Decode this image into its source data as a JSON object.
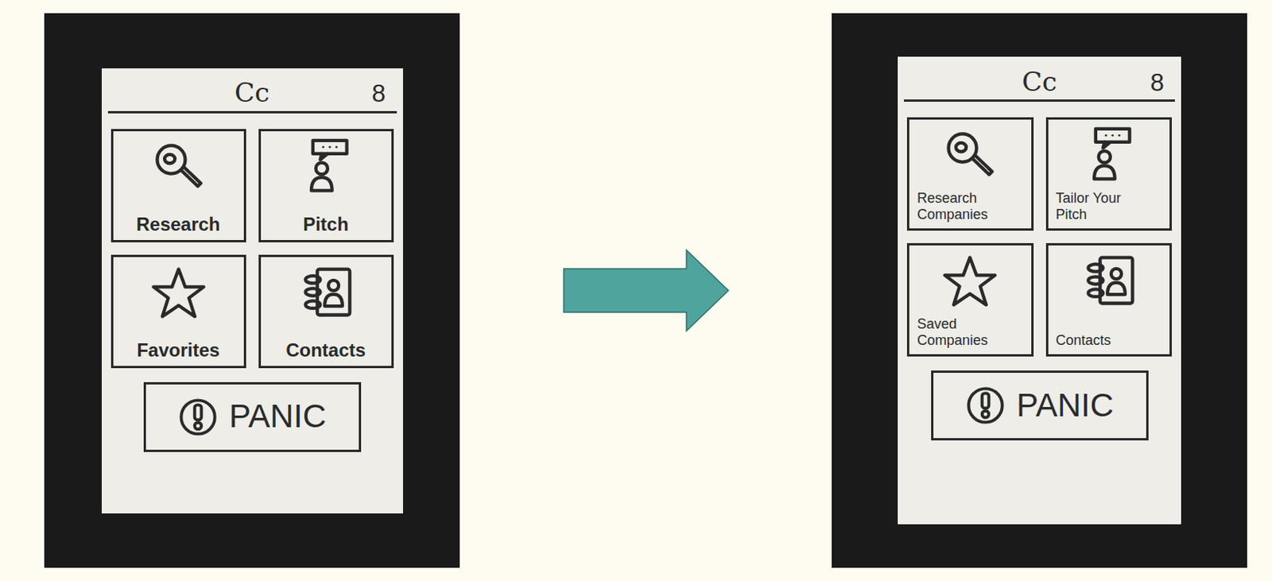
{
  "before": {
    "logo": "Cc",
    "profile": "8",
    "tiles": [
      {
        "label": "Research"
      },
      {
        "label": "Pitch"
      },
      {
        "label": "Favorites"
      },
      {
        "label": "Contacts"
      }
    ],
    "panic": "PANIC"
  },
  "after": {
    "logo": "Cc",
    "profile": "8",
    "tiles": [
      {
        "label": "Research Companies"
      },
      {
        "label": "Tailor Your Pitch"
      },
      {
        "label": "Saved Companies"
      },
      {
        "label": "Contacts"
      }
    ],
    "panic": "PANIC"
  }
}
